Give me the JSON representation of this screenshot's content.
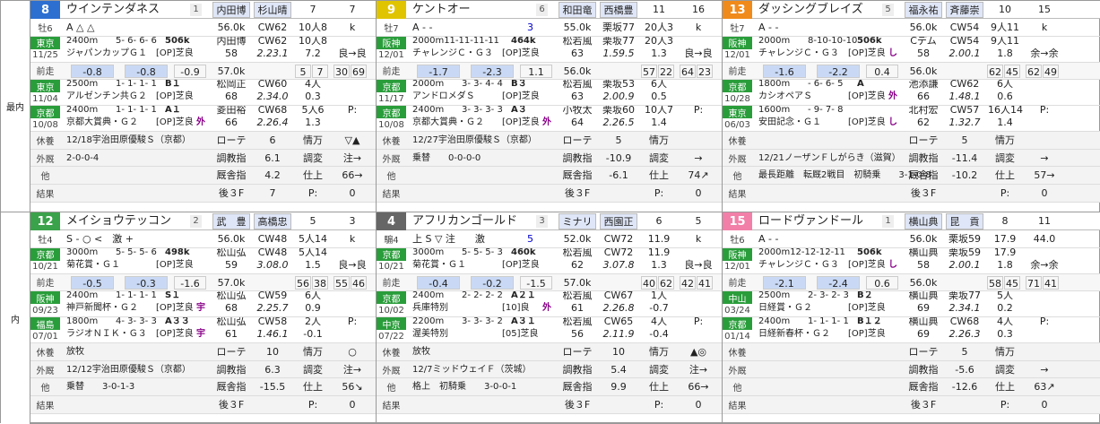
{
  "side": {
    "top": "最内",
    "bottom": "内"
  },
  "labels": {
    "prev": "前走",
    "rest": "休養",
    "gaishu": "外厩",
    "other": "他",
    "result": "結果",
    "rote": "ローテ",
    "chokyo_shi": "調教指",
    "kyusha_shi": "厩舎指",
    "ato3f": "後３F",
    "jiko": "情万",
    "chokyo_hen": "調変",
    "shiage": "仕上",
    "kaiten": "P:"
  },
  "horses": [
    {
      "num": "8",
      "numColor": "#2c6fd1",
      "name": "ウインテンダネス",
      "gate": "1",
      "jockey": "内田博",
      "trainer": "杉山晴",
      "col1": "7",
      "col2": "7",
      "sexage": "牡6",
      "marks": "A △ △",
      "tags": "",
      "r0": {
        "place": "東京",
        "date": "11/25",
        "dist": "2400m",
        "pos": "5- 6- 6- 6",
        "weight": "506k",
        "race": "ジャパンカップＧ１",
        "cls": "[OP]芝良",
        "jk": "内田博",
        "jw": "56.0k",
        "course": "CW62",
        "f": "10人8",
        "g": "k",
        "score": "58",
        "time": "2.23.1",
        "rank": "7.2",
        "odd": "良→良"
      },
      "pre": {
        "a": "-0.8",
        "b": "-0.8",
        "c": "-0.9",
        "w": "57.0k",
        "n1": "5",
        "n2": "7",
        "n3": "30",
        "n4": "69"
      },
      "r1": {
        "place": "東京",
        "date": "11/04",
        "dist": "2500m",
        "pos": "1- 1- 1- 1",
        "mark": "B１",
        "race": "アルゼンチン共Ｇ２",
        "cls": "[OP]芝良",
        "jk": "松岡正",
        "course": "CW60",
        "f": "4人",
        "fb": "4",
        "score": "68",
        "time": "2.34.0",
        "rank": "0.3"
      },
      "r2": {
        "place": "京都",
        "date": "10/08",
        "dist": "2400m",
        "pos": "1- 1- 1- 1",
        "mark": "A１",
        "race": "京都大賞典・Ｇ２",
        "cls": "[OP]芝良",
        "tail": "外",
        "jk": "菱田裕",
        "course": "CW68",
        "f": "5人6",
        "score": "66",
        "time": "2.26.4",
        "rank": "1.3",
        "p": "P:"
      },
      "rest": {
        "text": "12/18宇治田原優駿Ｓ（京都）",
        "rote": "6",
        "jiko": "▽▲"
      },
      "gai": {
        "text": "2-0-0-4",
        "chokyo": "6.1",
        "hen": "注→"
      },
      "oth": {
        "kyusha": "4.2",
        "shiage": "66→"
      },
      "res": {
        "ato": "7",
        "p": "0"
      }
    },
    {
      "num": "9",
      "numColor": "#e0c400",
      "name": "ケントオー",
      "gate": "6",
      "jockey": "和田竜",
      "trainer": "西橋豊",
      "col1": "11",
      "col2": "16",
      "sexage": "牡7",
      "marks": "A - -",
      "tags": "3",
      "r0": {
        "place": "阪神",
        "date": "12/01",
        "dist": "2000m11-11-11-11",
        "pos": "",
        "weight": "464k",
        "race": "チャレンジＣ・Ｇ３",
        "cls": "[OP]芝良",
        "jk": "松若風",
        "jw": "55.0k",
        "course": "栗坂77",
        "f": "20人3",
        "g": "k",
        "score": "63",
        "time": "1.59.5",
        "rank": "1.3",
        "odd": "良→良"
      },
      "pre": {
        "a": "-1.7",
        "b": "-2.3",
        "c": "1.1",
        "w": "56.0k",
        "n1": "57",
        "n2": "22",
        "n3": "64",
        "n4": "23"
      },
      "r1": {
        "place": "京都",
        "date": "11/17",
        "dist": "2000m",
        "pos": "3- 3- 4- 4",
        "mark": "B３",
        "race": "アンドロメダＳ",
        "cls": "[OP]芝良",
        "jk": "松若風",
        "course": "栗坂53",
        "f": "6人",
        "fb": "4",
        "score": "63",
        "time": "2.00.9",
        "rank": "0.5"
      },
      "r2": {
        "place": "京都",
        "date": "10/08",
        "dist": "2400m",
        "pos": "3- 3- 3- 3",
        "mark": "A３",
        "race": "京都大賞典・Ｇ２",
        "cls": "[OP]芝良",
        "tail": "外",
        "jk": "小牧太",
        "course": "栗坂60",
        "f": "10人7",
        "score": "64",
        "time": "2.26.5",
        "rank": "1.4",
        "p": "P:"
      },
      "rest": {
        "text": "12/27宇治田原優駿Ｓ（京都）",
        "rote": "5",
        "jiko": ""
      },
      "gai": {
        "text": "乗替　　0-0-0-0",
        "chokyo": "-10.9",
        "hen": "→"
      },
      "oth": {
        "kyusha": "-6.1",
        "shiage": "74↗"
      },
      "res": {
        "ato": "",
        "p": "0"
      }
    },
    {
      "num": "13",
      "numColor": "#f08a1a",
      "name": "ダッシングブレイズ",
      "gate": "5",
      "jockey": "福永祐",
      "trainer": "斉藤崇",
      "col1": "10",
      "col2": "15",
      "sexage": "牡7",
      "marks": "A - -",
      "tags": "",
      "r0": {
        "place": "阪神",
        "date": "12/01",
        "dist": "2000m",
        "pos": "8-10-10-10",
        "weight": "506k",
        "race": "チャレンジＣ・Ｇ３",
        "cls": "[OP]芝良",
        "tail": "し",
        "jk": "Cデム",
        "jw": "56.0k",
        "course": "CW54",
        "f": "9人11",
        "g": "k",
        "score": "58",
        "time": "2.00.1",
        "rank": "1.8",
        "odd": "余→余"
      },
      "pre": {
        "a": "-1.6",
        "b": "-2.2",
        "c": "0.4",
        "w": "56.0k",
        "n1": "62",
        "n2": "45",
        "n3": "62",
        "n4": "49"
      },
      "r1": {
        "place": "京都",
        "date": "10/28",
        "dist": "1800m",
        "pos": "- 6- 6- 5",
        "mark": "A",
        "race": "カシオペアＳ",
        "cls": "[OP]芝良",
        "tail": "外",
        "jk": "池添謙",
        "course": "CW62",
        "f": "6人",
        "fb": "5",
        "score": "66",
        "time": "1.48.1",
        "rank": "0.6"
      },
      "r2": {
        "place": "東京",
        "date": "06/03",
        "dist": "1600m",
        "pos": "- 9- 7- 8",
        "mark": "",
        "race": "安田記念・Ｇ１",
        "cls": "[OP]芝良",
        "tail": "し",
        "jk": "北村宏",
        "course": "CW57",
        "f": "16人14",
        "score": "62",
        "time": "1.32.7",
        "rank": "1.4",
        "p": "P:"
      },
      "rest": {
        "text": "",
        "rote": "5",
        "jiko": ""
      },
      "gai": {
        "text": "12/21ノーザンＦしがらき（滋賀）",
        "chokyo": "-11.4",
        "hen": "→"
      },
      "oth": {
        "text": "最長距離　転厩2戦目　初騎乗　　3-1-0-8",
        "kyusha": "-10.2",
        "shiage": "57→"
      },
      "res": {
        "ato": "",
        "p": "0"
      }
    },
    {
      "num": "12",
      "numColor": "#3aa24a",
      "name": "メイショウテッコン",
      "gate": "2",
      "jockey": "武　豊",
      "trainer": "高橋忠",
      "col1": "5",
      "col2": "3",
      "sexage": "牡4",
      "marks": "S - ○ <　激 +",
      "tags": "",
      "r0": {
        "place": "京都",
        "date": "10/21",
        "dist": "3000m",
        "pos": "5- 5- 5- 6",
        "weight": "498k",
        "race": "菊花賞・Ｇ１",
        "cls": "[OP]芝良",
        "jk": "松山弘",
        "jw": "56.0k",
        "course": "CW48",
        "f": "5人14",
        "g": "k",
        "score": "59",
        "time": "3.08.0",
        "rank": "1.5",
        "odd": "良→良"
      },
      "pre": {
        "a": "-0.5",
        "b": "-0.3",
        "c": "-1.6",
        "w": "57.0k",
        "n1": "56",
        "n2": "38",
        "n3": "55",
        "n4": "46"
      },
      "r1": {
        "place": "阪神",
        "date": "09/23",
        "dist": "2400m",
        "pos": "1- 1- 1- 1",
        "mark": "S１",
        "race": "神戸新聞杯・Ｇ２",
        "cls": "[OP]芝良",
        "tail": "宇",
        "jk": "松山弘",
        "course": "CW59",
        "f": "6人",
        "fb": "3",
        "score": "68",
        "time": "2.25.7",
        "rank": "0.9"
      },
      "r2": {
        "place": "福島",
        "date": "07/01",
        "dist": "1800m",
        "pos": "4- 3- 3- 3",
        "mark": "A３３",
        "race": "ラジオＮＩＫ・Ｇ３",
        "cls": "[OP]芝良",
        "tail": "宇",
        "jk": "松山弘",
        "course": "CW58",
        "f": "2人",
        "fb": "1",
        "score": "61",
        "time": "1.46.1",
        "rank": "-0.1",
        "p": "P:"
      },
      "rest": {
        "text": "放牧",
        "rote": "10",
        "jiko": "○"
      },
      "gai": {
        "text": "12/12宇治田原優駿Ｓ（京都）",
        "chokyo": "6.3",
        "hen": "注→"
      },
      "oth": {
        "text": "乗替　　3-0-1-3",
        "kyusha": "-15.5",
        "shiage": "56↘"
      },
      "res": {
        "ato": "",
        "p": "0"
      }
    },
    {
      "num": "4",
      "numColor": "#666666",
      "name": "アフリカンゴールド",
      "gate": "3",
      "jockey": "ミナリ",
      "trainer": "西園正",
      "col1": "6",
      "col2": "5",
      "sexage": "騸4",
      "marks": "上 S ▽ 注　　激",
      "tags": "5",
      "r0": {
        "place": "京都",
        "date": "10/21",
        "dist": "3000m",
        "pos": "5- 5- 5- 3",
        "weight": "460k",
        "race": "菊花賞・Ｇ１",
        "cls": "[OP]芝良",
        "jk": "松若風",
        "jw": "52.0k",
        "course": "CW72",
        "f": "11.9",
        "g": "k",
        "score": "62",
        "time": "3.07.8",
        "rank": "1.3",
        "odd": "良→良"
      },
      "pre": {
        "a": "-0.4",
        "b": "-0.2",
        "c": "-1.5",
        "w": "57.0k",
        "n1": "40",
        "n2": "62",
        "n3": "42",
        "n4": "41"
      },
      "r1": {
        "place": "京都",
        "date": "10/02",
        "dist": "2400m",
        "pos": "2- 2- 2- 2",
        "mark": "A２１",
        "race": "兵庫特別",
        "cls": "[10]良",
        "tail": "外",
        "jk": "松若風",
        "course": "CW67",
        "f": "1人",
        "fb": "1",
        "score": "61",
        "time": "2.26.8",
        "rank": "-0.7"
      },
      "r2": {
        "place": "中京",
        "date": "07/22",
        "dist": "2200m",
        "pos": "3- 3- 3- 2",
        "mark": "A３１",
        "race": "渥美特別",
        "cls": "[05]芝良",
        "jk": "松若風",
        "course": "CW65",
        "f": "4人",
        "fb": "1",
        "score": "56",
        "time": "2.11.9",
        "rank": "-0.4",
        "p": "P:"
      },
      "rest": {
        "text": "放牧",
        "rote": "10",
        "jiko": "▲◎"
      },
      "gai": {
        "text": "12/7ミッドウェイＦ（茨城）",
        "chokyo": "5.4",
        "hen": "注→"
      },
      "oth": {
        "text": "格上　初騎乗　　3-0-0-1",
        "kyusha": "9.9",
        "shiage": "66→"
      },
      "res": {
        "ato": "",
        "p": "0"
      }
    },
    {
      "num": "15",
      "numColor": "#f27fa8",
      "name": "ロードヴァンドール",
      "gate": "1",
      "jockey": "横山典",
      "trainer": "昆　貢",
      "col1": "8",
      "col2": "11",
      "sexage": "牡6",
      "marks": "A - -",
      "tags": "",
      "r0": {
        "place": "阪神",
        "date": "12/01",
        "dist": "2000m12-12-12-11",
        "pos": "",
        "weight": "506k",
        "race": "チャレンジＣ・Ｇ３",
        "cls": "[OP]芝良",
        "tail": "し",
        "jk": "横山典",
        "jw": "56.0k",
        "course": "栗坂59",
        "f": "17.9",
        "g": "44.0",
        "score": "58",
        "time": "2.00.1",
        "rank": "1.8",
        "odd": "余→余"
      },
      "pre": {
        "a": "-2.1",
        "b": "-2.4",
        "c": "0.6",
        "w": "56.0k",
        "n1": "58",
        "n2": "45",
        "n3": "71",
        "n4": "41"
      },
      "r1": {
        "place": "中山",
        "date": "03/24",
        "dist": "2500m",
        "pos": "2- 3- 2- 3",
        "mark": "B２",
        "race": "日経賞・Ｇ２",
        "cls": "[OP]芝良",
        "jk": "横山典",
        "course": "栗坂77",
        "f": "5人",
        "fb": "",
        "score": "69",
        "time": "2.34.1",
        "rank": "0.2"
      },
      "r2": {
        "place": "京都",
        "date": "01/14",
        "dist": "2400m",
        "pos": "1- 1- 1- 1",
        "mark": "B１２",
        "race": "日経新春杯・Ｇ２",
        "cls": "[OP]芝良",
        "jk": "横山典",
        "course": "CW68",
        "f": "4人",
        "fb": "2",
        "score": "69",
        "time": "2.26.3",
        "rank": "0.3",
        "p": "P:"
      },
      "rest": {
        "text": "",
        "rote": "5",
        "jiko": ""
      },
      "gai": {
        "text": "",
        "chokyo": "-5.6",
        "hen": "→"
      },
      "oth": {
        "text": "",
        "kyusha": "-12.6",
        "shiage": "63↗"
      },
      "res": {
        "ato": "",
        "p": "0"
      }
    }
  ]
}
